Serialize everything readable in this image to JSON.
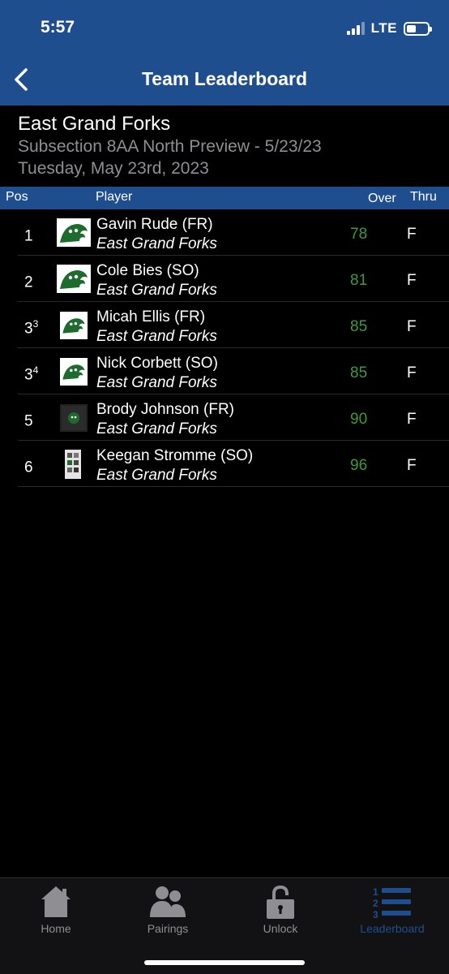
{
  "status_bar": {
    "time": "5:57",
    "network": "LTE"
  },
  "nav": {
    "title": "Team Leaderboard",
    "back_icon": "chevron-left-icon"
  },
  "event": {
    "team": "East Grand Forks",
    "name": "Subsection 8AA North Preview - 5/23/23",
    "date": "Tuesday, May 23rd, 2023"
  },
  "columns": {
    "pos": "Pos",
    "player": "Player",
    "over": "Over",
    "thru": "Thru"
  },
  "rows": [
    {
      "pos": "1",
      "pos_sup": "",
      "name": "Gavin Rude (FR)",
      "team": "East Grand Forks",
      "over": "78",
      "thru": "F"
    },
    {
      "pos": "2",
      "pos_sup": "",
      "name": "Cole Bies (SO)",
      "team": "East Grand Forks",
      "over": "81",
      "thru": "F"
    },
    {
      "pos": "3",
      "pos_sup": "3",
      "name": "Micah Ellis (FR)",
      "team": "East Grand Forks",
      "over": "85",
      "thru": "F"
    },
    {
      "pos": "3",
      "pos_sup": "4",
      "name": "Nick Corbett (SO)",
      "team": "East Grand Forks",
      "over": "85",
      "thru": "F"
    },
    {
      "pos": "5",
      "pos_sup": "",
      "name": "Brody Johnson (FR)",
      "team": "East Grand Forks",
      "over": "90",
      "thru": "F"
    },
    {
      "pos": "6",
      "pos_sup": "",
      "name": "Keegan Stromme (SO)",
      "team": "East Grand Forks",
      "over": "96",
      "thru": "F"
    }
  ],
  "tabs": [
    {
      "label": "Home",
      "icon": "home-icon"
    },
    {
      "label": "Pairings",
      "icon": "people-icon"
    },
    {
      "label": "Unlock",
      "icon": "unlock-icon"
    },
    {
      "label": "Leaderboard",
      "icon": "leaderboard-icon",
      "active": true
    }
  ],
  "colors": {
    "brand": "#1f4e8f",
    "score": "#3f9a3a",
    "muted": "#8e8e93"
  }
}
